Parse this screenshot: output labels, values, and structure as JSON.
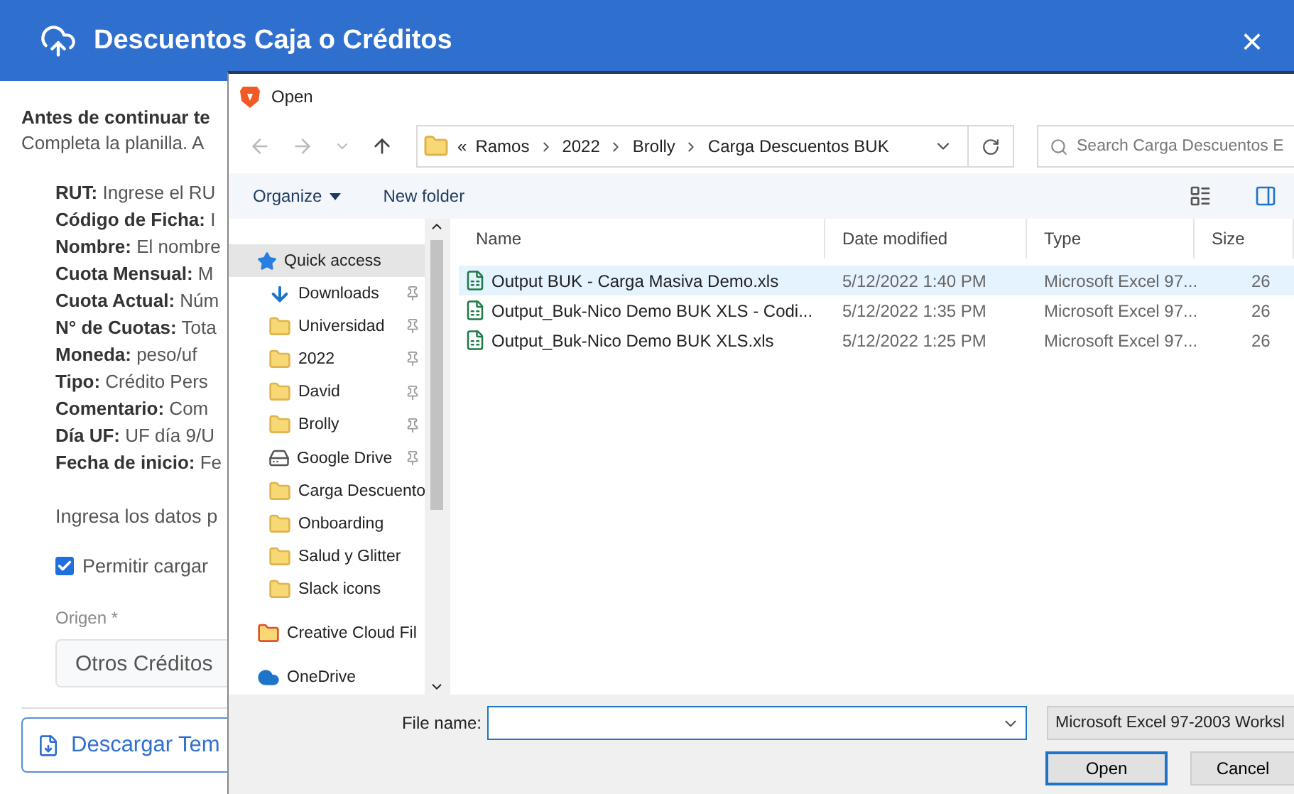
{
  "modal": {
    "title": "Descuentos Caja o Créditos",
    "close": "×"
  },
  "intro": {
    "heading": "Antes de continuar te",
    "text": "Completa la planilla. A"
  },
  "fields": [
    "**RUT:** Ingrese el RU",
    "**Código de Ficha:** I",
    "**Nombre:** El nombre",
    "**Cuota Mensual:** M",
    "**Cuota Actual:** Núm",
    "**N° de Cuotas:** Tota",
    "**Moneda:** peso/uf",
    "**Tipo:** Crédito Pers",
    "**Comentario:** Com",
    "**Día UF:** UF día 9/U",
    "**Fecha de inicio:** Fe"
  ],
  "instructions": "Ingresa los datos p",
  "allow_upload": {
    "label": "Permitir cargar",
    "checked": true
  },
  "origin": {
    "label": "Origen *",
    "value": "Otros Créditos"
  },
  "download_button": "Descargar Tem",
  "dialog": {
    "title": "Open",
    "path": [
      "Ramos",
      "2022",
      "Brolly",
      "Carga Descuentos BUK"
    ],
    "path_prefix": "«",
    "search": {
      "placeholder": "Search Carga Descuentos E"
    },
    "toolbar": {
      "organize": "Organize",
      "new_folder": "New folder"
    },
    "nav_items": [
      {
        "kind": "star",
        "label": "Quick access",
        "pinned": false,
        "selected": true
      },
      {
        "kind": "download",
        "label": "Downloads",
        "pinned": true,
        "selected": false
      },
      {
        "kind": "folder",
        "label": "Universidad",
        "pinned": true,
        "selected": false
      },
      {
        "kind": "folder",
        "label": "2022",
        "pinned": true,
        "selected": false
      },
      {
        "kind": "folder",
        "label": "David",
        "pinned": true,
        "selected": false
      },
      {
        "kind": "folder",
        "label": "Brolly",
        "pinned": true,
        "selected": false
      },
      {
        "kind": "drive",
        "label": "Google Drive",
        "pinned": true,
        "selected": false
      },
      {
        "kind": "folder",
        "label": "Carga Descuento",
        "pinned": false,
        "selected": false
      },
      {
        "kind": "folder",
        "label": "Onboarding",
        "pinned": false,
        "selected": false
      },
      {
        "kind": "folder",
        "label": "Salud y Glitter",
        "pinned": false,
        "selected": false
      },
      {
        "kind": "folder",
        "label": "Slack icons",
        "pinned": false,
        "selected": false
      },
      {
        "kind": "creative",
        "label": "Creative Cloud Fil",
        "pinned": false,
        "selected": false
      },
      {
        "kind": "cloud",
        "label": "OneDrive",
        "pinned": false,
        "selected": false
      }
    ],
    "columns": [
      "Name",
      "Date modified",
      "Type",
      "Size"
    ],
    "files": [
      {
        "name": "Output BUK - Carga Masiva Demo.xls",
        "date": "5/12/2022 1:40 PM",
        "type": "Microsoft Excel 97...",
        "size": "26",
        "selected": true
      },
      {
        "name": "Output_Buk-Nico Demo BUK XLS - Codi...",
        "date": "5/12/2022 1:35 PM",
        "type": "Microsoft Excel 97...",
        "size": "26",
        "selected": false
      },
      {
        "name": "Output_Buk-Nico Demo BUK XLS.xls",
        "date": "5/12/2022 1:25 PM",
        "type": "Microsoft Excel 97...",
        "size": "26",
        "selected": false
      }
    ],
    "file_name_label": "File name:",
    "file_type": "Microsoft Excel 97-2003 Worksl",
    "buttons": [
      "Open",
      "Cancel"
    ]
  }
}
